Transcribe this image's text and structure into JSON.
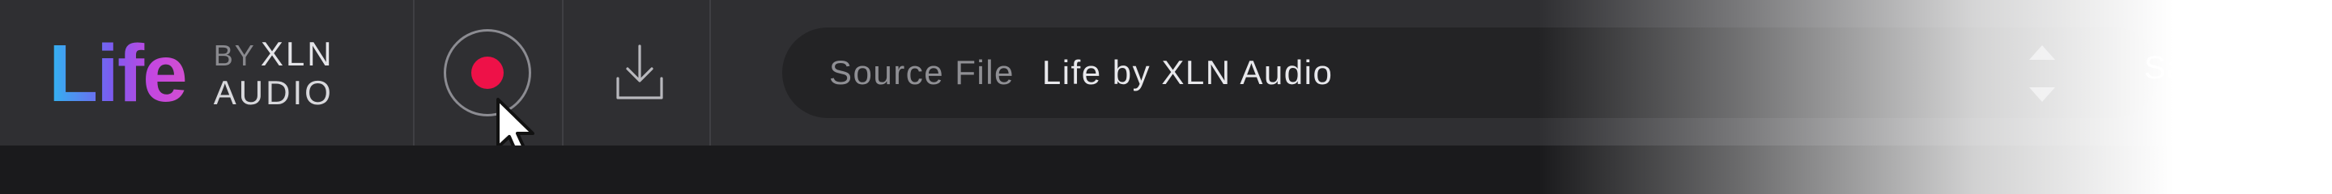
{
  "logo": {
    "wordmark": "Life",
    "by": "BY",
    "brand": "XLN",
    "brand_sub": "AUDIO"
  },
  "toolbar": {
    "record_icon": "record-icon",
    "download_icon": "download-icon",
    "cursor_icon": "pointer-cursor-icon"
  },
  "source": {
    "label": "Source File",
    "value": "Life by XLN Audio"
  },
  "save": {
    "label": "Save"
  },
  "colors": {
    "record_red": "#ee1148",
    "toolbar_bg": "#2f2f32",
    "field_bg": "#232325",
    "logo_gradient_start": "#2fb6f0",
    "logo_gradient_end": "#d24fd0"
  }
}
